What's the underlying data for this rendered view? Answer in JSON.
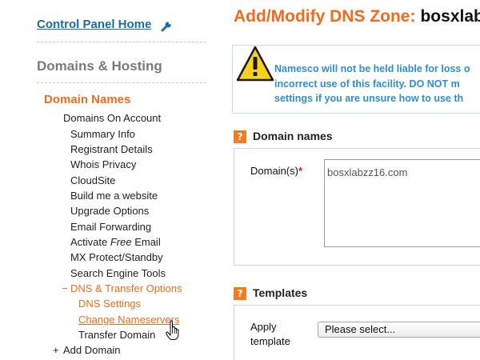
{
  "sidebar": {
    "control_panel_home": "Control Panel Home",
    "section_heading": "Domains & Hosting",
    "domain_names_heading": "Domain Names",
    "items": {
      "domains_on_account": "Domains On Account",
      "summary_info": "Summary Info",
      "registrant_details": "Registrant Details",
      "whois_privacy": "Whois Privacy",
      "cloudsite": "CloudSite",
      "build_website": "Build me a website",
      "upgrade_options": "Upgrade Options",
      "email_forwarding": "Email Forwarding",
      "activate_prefix": "Activate ",
      "activate_free": "Free",
      "activate_suffix": " Email",
      "mx_protect": "MX Protect/Standby",
      "search_engine_tools": "Search Engine Tools",
      "dns_transfer_marker": "−",
      "dns_transfer_options": "DNS & Transfer Options",
      "dns_settings": "DNS Settings",
      "change_nameservers": "Change Nameservers",
      "transfer_domain": "Transfer Domain",
      "add_domain_marker": "+",
      "add_domain": "Add Domain"
    }
  },
  "main": {
    "title_prefix": "Add/Modify DNS Zone:",
    "title_zone": "bosxlabz",
    "warning_lines": [
      "Namesco will not be held liable for loss o",
      "incorrect use of this facility. DO NOT m",
      "settings if you are unsure how to use th"
    ],
    "domain_names_section": {
      "title": "Domain names",
      "help_icon": "?",
      "domains_label": "Domain(s)",
      "required_marker": "*",
      "domains_value": "bosxlabzz16.com"
    },
    "templates_section": {
      "title": "Templates",
      "help_icon": "?",
      "apply_label_line1": "Apply",
      "apply_label_line2": "template",
      "select_value": "Please select..."
    }
  },
  "colors": {
    "accent_orange": "#f26a1b",
    "link_blue": "#1a6ea0",
    "warning_blue": "#2c8fd0",
    "help_icon_orange": "#f47b20",
    "section_grey": "#7a7a7a"
  },
  "icons": [
    "wrench-icon",
    "warning-icon",
    "help-icon",
    "hand-cursor-icon"
  ]
}
